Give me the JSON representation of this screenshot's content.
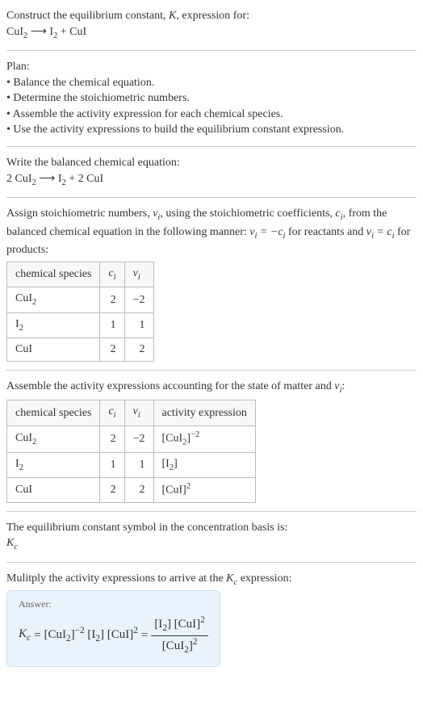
{
  "intro": {
    "line1_pre": "Construct the equilibrium constant, ",
    "line1_var": "K",
    "line1_post": ", expression for:",
    "equation": "CuI₂ ⟶ I₂ + CuI"
  },
  "plan": {
    "title": "Plan:",
    "b1": "• Balance the chemical equation.",
    "b2": "• Determine the stoichiometric numbers.",
    "b3": "• Assemble the activity expression for each chemical species.",
    "b4": "• Use the activity expressions to build the equilibrium constant expression."
  },
  "balanced": {
    "title": "Write the balanced chemical equation:",
    "equation": "2 CuI₂ ⟶ I₂ + 2 CuI"
  },
  "stoich": {
    "text_a": "Assign stoichiometric numbers, ",
    "text_b": ", using the stoichiometric coefficients, ",
    "text_c": ", from the balanced chemical equation in the following manner: ",
    "text_d": " for reactants and ",
    "text_e": " for products:",
    "head_species": "chemical species",
    "row1_sp": "CuI₂",
    "row1_c": "2",
    "row1_v": "−2",
    "row2_sp": "I₂",
    "row2_c": "1",
    "row2_v": "1",
    "row3_sp": "CuI",
    "row3_c": "2",
    "row3_v": "2"
  },
  "activity": {
    "text_a": "Assemble the activity expressions accounting for the state of matter and ",
    "text_b": ":",
    "head_species": "chemical species",
    "head_act": "activity expression",
    "row1_sp": "CuI₂",
    "row1_c": "2",
    "row1_v": "−2",
    "row2_sp": "I₂",
    "row2_c": "1",
    "row2_v": "1",
    "row3_sp": "CuI",
    "row3_c": "2",
    "row3_v": "2"
  },
  "basis": {
    "line": "The equilibrium constant symbol in the concentration basis is:"
  },
  "multiply": {
    "line_a": "Mulitply the activity expressions to arrive at the ",
    "line_b": " expression:"
  },
  "answer": {
    "label": "Answer:"
  },
  "chart_data": {
    "type": "table",
    "tables": [
      {
        "columns": [
          "chemical species",
          "c_i",
          "ν_i"
        ],
        "rows": [
          [
            "CuI2",
            2,
            -2
          ],
          [
            "I2",
            1,
            1
          ],
          [
            "CuI",
            2,
            2
          ]
        ]
      },
      {
        "columns": [
          "chemical species",
          "c_i",
          "ν_i",
          "activity expression"
        ],
        "rows": [
          [
            "CuI2",
            2,
            -2,
            "[CuI2]^-2"
          ],
          [
            "I2",
            1,
            1,
            "[I2]"
          ],
          [
            "CuI",
            2,
            2,
            "[CuI]^2"
          ]
        ]
      }
    ],
    "equilibrium_expression": "K_c = [CuI2]^-2 [I2] [CuI]^2 = ([I2] [CuI]^2) / [CuI2]^2"
  }
}
